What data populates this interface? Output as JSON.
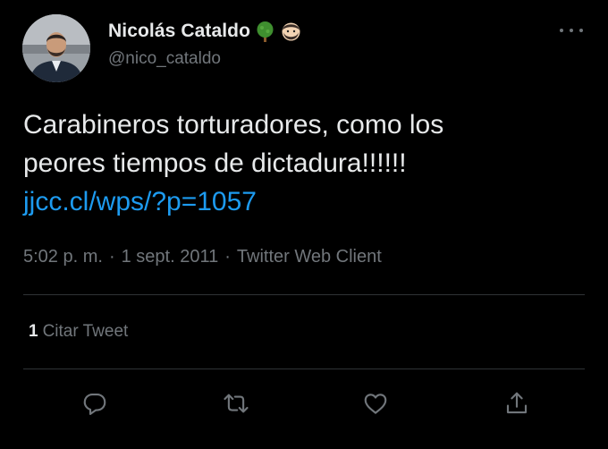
{
  "user": {
    "display_name": "Nicolás Cataldo",
    "handle": "@nico_cataldo",
    "badges": [
      "tree-emoji",
      "man-with-beard-emoji"
    ]
  },
  "tweet": {
    "text_line1": "Carabineros torturadores, como los",
    "text_line2": "peores tiempos de dictadura!!!!!!",
    "link": "jjcc.cl/wps/?p=1057",
    "time": "5:02 p. m.",
    "separator": "·",
    "date": "1 sept. 2011",
    "source": "Twitter Web Client"
  },
  "stats": {
    "quote_count": "1",
    "quote_label": "Citar Tweet"
  },
  "actions": [
    "reply-icon",
    "retweet-icon",
    "like-icon",
    "share-icon"
  ],
  "colors": {
    "background": "#000000",
    "text": "#e7e9ea",
    "secondary": "#71767b",
    "link": "#1d9bf0",
    "divider": "#2f3336"
  }
}
